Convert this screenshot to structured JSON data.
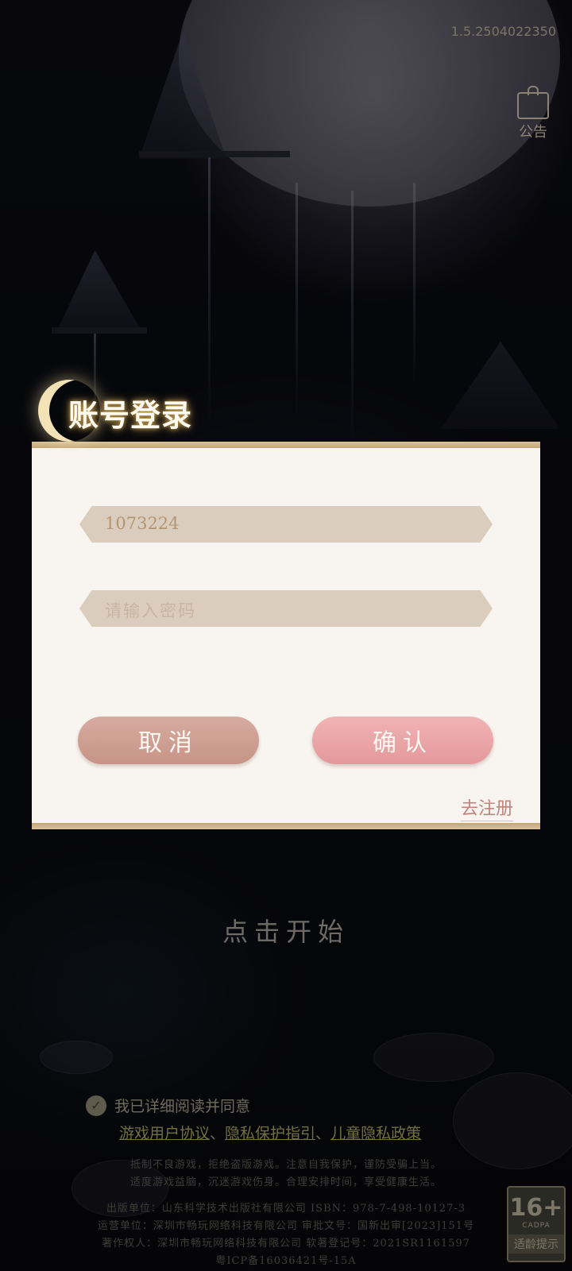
{
  "header": {
    "version": "1.5.2504022350",
    "notice_label": "公告"
  },
  "background": {
    "start_prompt": "点击开始"
  },
  "agreement": {
    "checked": true,
    "text": "我已详细阅读并同意",
    "link_user": "游戏用户协议",
    "sep1": "、",
    "link_privacy": "隐私保护指引",
    "sep2": "、",
    "link_child": "儿童隐私政策"
  },
  "footer": {
    "line1": "抵制不良游戏，拒绝盗版游戏。注意自我保护，谨防受骗上当。",
    "line2": "适度游戏益脑，沉迷游戏伤身。合理安排时间，享受健康生活。",
    "line3": "出版单位：山东科学技术出版社有限公司 ISBN：978-7-498-10127-3",
    "line4": "运营单位：深圳市畅玩网络科技有限公司 审批文号：国新出审[2023]151号",
    "line5": "著作权人：深圳市畅玩网络科技有限公司 软著登记号：2021SR1161597",
    "line6": "粤ICP备16036421号-15A"
  },
  "age_rating": {
    "age": "16+",
    "org": "CADPA",
    "label": "适龄提示"
  },
  "login_modal": {
    "title": "账号登录",
    "username_value": "1073224",
    "password_placeholder": "请输入密码",
    "cancel_label": "取消",
    "confirm_label": "确认",
    "register_label": "去注册"
  },
  "colors": {
    "modal_bg": "#f8f4ef",
    "field_bg": "#dbcdbd",
    "cancel_btn": "#cf9f94",
    "confirm_btn": "#eaa5a7",
    "gold_border": "#c9ad7e"
  }
}
